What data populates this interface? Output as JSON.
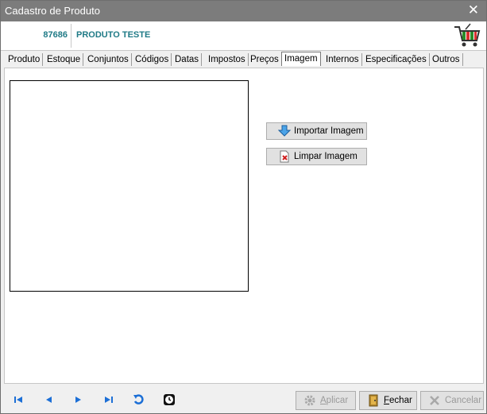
{
  "window": {
    "title": "Cadastro de Produto",
    "close_glyph": "✕"
  },
  "header": {
    "code": "87686",
    "product_name": "PRODUTO TESTE",
    "icon": "shopping-cart-icon"
  },
  "tabs": [
    {
      "label": "Produto",
      "active": false
    },
    {
      "label": "Estoque",
      "active": false
    },
    {
      "label": "Conjuntos",
      "active": false
    },
    {
      "label": "Códigos",
      "active": false
    },
    {
      "label": "Datas",
      "active": false
    },
    {
      "label": "Impostos",
      "active": false
    },
    {
      "label": "Preços",
      "active": false
    },
    {
      "label": "Imagem",
      "active": true
    },
    {
      "label": "Internos",
      "active": false
    },
    {
      "label": "Especificações",
      "active": false
    },
    {
      "label": "Outros",
      "active": false
    }
  ],
  "image_panel": {
    "import_label": "Importar Imagem",
    "clear_label": "Limpar Imagem"
  },
  "footer": {
    "nav": [
      "first-record-icon",
      "previous-record-icon",
      "next-record-icon",
      "last-record-icon",
      "refresh-icon",
      "history-icon"
    ],
    "apply_label": "Aplicar",
    "close_label": "Fechar",
    "cancel_label": "Cancelar",
    "apply_enabled": false,
    "close_enabled": true,
    "cancel_enabled": false
  },
  "colors": {
    "accent": "#1f7a86",
    "nav_blue": "#1c6fd6",
    "titlebar": "#7c7c7c"
  }
}
